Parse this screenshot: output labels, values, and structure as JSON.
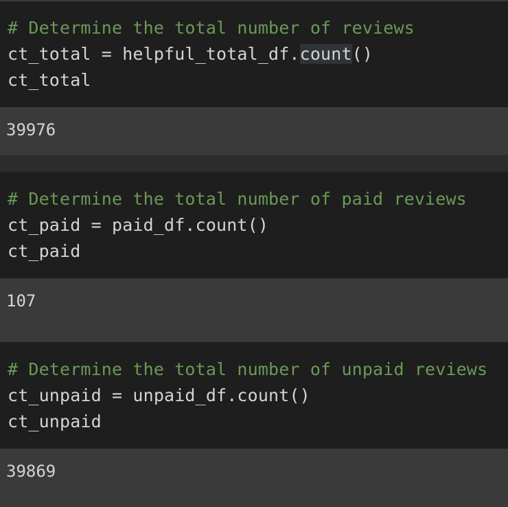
{
  "cells": [
    {
      "comment": "# Determine the total number of reviews",
      "code_line_1_pre": "ct_total = helpful_total_df.",
      "code_line_1_hl": "count",
      "code_line_1_post": "()",
      "code_line_2": "ct_total",
      "output": "39976"
    },
    {
      "comment": "# Determine the total number of paid reviews",
      "code_line_1": "ct_paid = paid_df.count()",
      "code_line_2": "ct_paid",
      "output": "107"
    },
    {
      "comment": "# Determine the total number of unpaid reviews",
      "code_line_1": "ct_unpaid = unpaid_df.count()",
      "code_line_2": "ct_unpaid",
      "output": "39869"
    }
  ]
}
